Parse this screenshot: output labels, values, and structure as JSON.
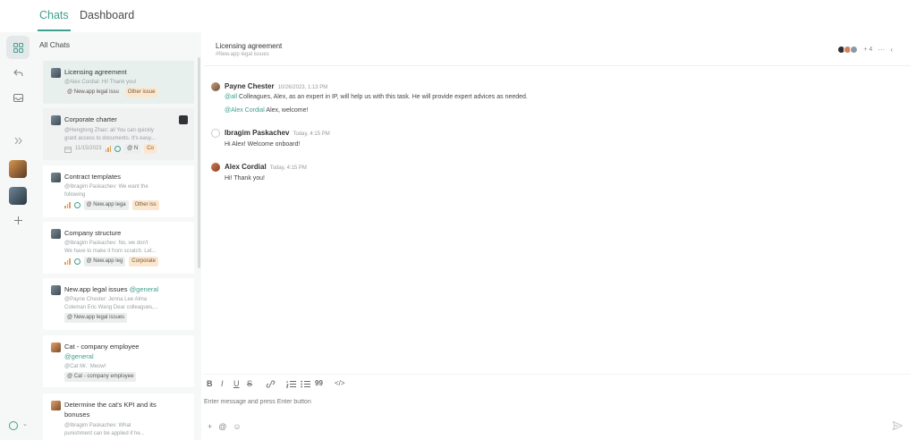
{
  "tabs": [
    {
      "label": "Chats"
    },
    {
      "label": "Dashboard"
    }
  ],
  "sidebar": {
    "header": "All Chats"
  },
  "chats": [
    {
      "title": "Licensing agreement",
      "lines": [
        "@Alex Cordial: Hi! Thank you!"
      ],
      "tags": [
        "@ New.app legal issu",
        "Other issue"
      ]
    },
    {
      "title": "Corporate charter",
      "lines": [
        "@Hengtong Zhao: all You can quickly",
        "grant access to documents. It's easy..."
      ],
      "date": "11/15/2023",
      "tags": [
        "@ N",
        "Co"
      ]
    },
    {
      "title": "Contract templates",
      "lines": [
        "@Ibragim Paskachev: We want the",
        "following"
      ],
      "tags": [
        "@ New.app lega",
        "Other iss"
      ]
    },
    {
      "title": "Company structure",
      "lines": [
        "@Ibragim Paskachev: No, we don't",
        "We have to make it from scratch. Let..."
      ],
      "tags": [
        "@ New.app leg",
        "Corporate"
      ]
    },
    {
      "title": "New.app legal issues",
      "title_mention": "@general",
      "lines": [
        "@Payne Chester: Jenna Lee Alma",
        "Coleman Eric Wang Dear colleagues,..."
      ],
      "tags": [
        "@ New.app legal issues"
      ]
    },
    {
      "title": "Cat - company employee",
      "title_mention": "@general",
      "lines": [
        "@Cat Mr.: Meow!"
      ],
      "tags": [
        "@ Cat - company employee"
      ]
    },
    {
      "title": "Determine the cat's KPI and its",
      "title2": "bonuses",
      "lines": [
        "@Ibragim Paskachev: What",
        "punishment can be applied if he..."
      ]
    }
  ],
  "conversation": {
    "title": "Licensing agreement",
    "subtitle": "#New.app legal issues",
    "member_count": "+ 4",
    "messages": [
      {
        "author": "Payne Chester",
        "time": "10/26/2023, 1:13 PM",
        "lines": [
          {
            "mention": "@all",
            "text": " Colleagues, Alex, as an expert in IP, will help us with this task. He will provide expert advices as needed."
          },
          {
            "mention": "@Alex Cordial",
            "text": " Alex, welcome!"
          }
        ]
      },
      {
        "author": "Ibragim Paskachev",
        "time": "Today, 4:15 PM",
        "lines": [
          {
            "mention": "",
            "text": "Hi Alex! Welcome onboard!"
          }
        ]
      },
      {
        "author": "Alex Cordial",
        "time": "Today, 4:15 PM",
        "lines": [
          {
            "mention": "",
            "text": "Hi! Thank you!"
          }
        ]
      }
    ]
  },
  "composer": {
    "placeholder": "Enter message and press Enter button",
    "toolbar": [
      "B",
      "I",
      "U",
      "S",
      "link",
      "ol",
      "ul",
      "99",
      "</>"
    ]
  },
  "colors": {
    "accent": "#3e9f8e",
    "orange": "#e2a05a"
  }
}
